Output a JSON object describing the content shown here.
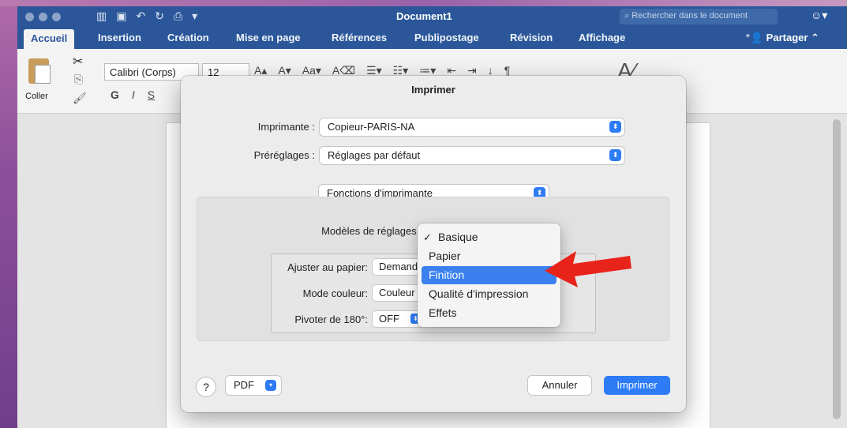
{
  "word": {
    "title": "Document1",
    "search_placeholder": "Rechercher dans le document",
    "tabs": [
      "Accueil",
      "Insertion",
      "Création",
      "Mise en page",
      "Références",
      "Publipostage",
      "Révision",
      "Affichage"
    ],
    "share_label": "Partager",
    "ribbon": {
      "paste_label": "Coller",
      "font_name": "Calibri (Corps)",
      "font_size": "12"
    }
  },
  "dialog": {
    "title": "Imprimer",
    "printer_label": "Imprimante :",
    "printer_value": "Copieur-PARIS-NA",
    "presets_label": "Préréglages :",
    "presets_value": "Réglages par défaut",
    "section_value": "Fonctions d'imprimante",
    "models_label": "Modèles de réglages :",
    "fit_label": "Ajuster au papier:",
    "fit_value": "Demande",
    "color_label": "Mode couleur:",
    "color_value": "Couleur",
    "rotate_label": "Pivoter de 180°:",
    "rotate_value": "OFF",
    "menu": {
      "items": [
        "Basique",
        "Papier",
        "Finition",
        "Qualité d'impression",
        "Effets"
      ],
      "checked_item": "Basique",
      "highlighted_item": "Finition"
    },
    "help_label": "?",
    "pdf_label": "PDF",
    "cancel_label": "Annuler",
    "print_label": "Imprimer"
  },
  "colors": {
    "word_blue": "#2b579a",
    "accent": "#2d7cf6",
    "menu_highlight": "#3a80ee",
    "arrow": "#e8231a"
  }
}
